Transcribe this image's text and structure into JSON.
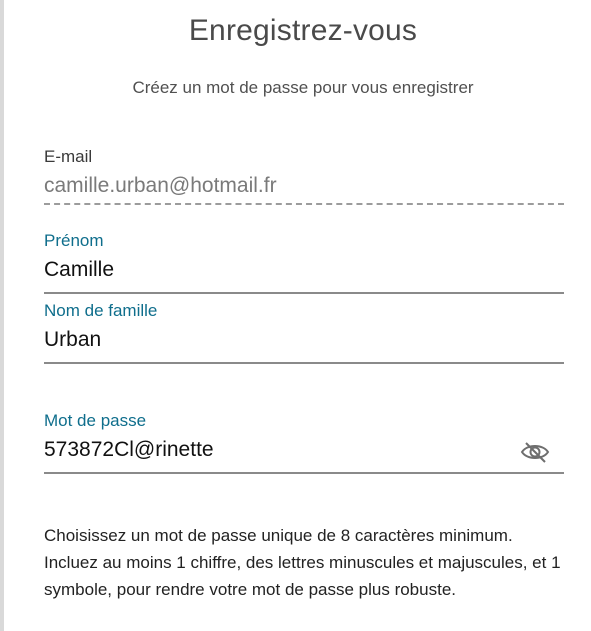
{
  "header": {
    "title": "Enregistrez-vous",
    "subtitle": "Créez un mot de passe pour vous enregistrer"
  },
  "form": {
    "email": {
      "label": "E-mail",
      "value": "camille.urban@hotmail.fr"
    },
    "first_name": {
      "label": "Prénom",
      "value": "Camille"
    },
    "last_name": {
      "label": "Nom de famille",
      "value": "Urban"
    },
    "password": {
      "label": "Mot de passe",
      "value": "573872Cl@rinette",
      "toggle_icon": "eye-slash-icon"
    }
  },
  "help": {
    "text": "Choisissez un mot de passe unique de 8 caractères minimum. Incluez au moins 1 chiffre, des lettres minuscules et majuscules, et 1 symbole, pour rendre votre mot de passe plus robuste."
  },
  "colors": {
    "label_accent": "#0f6e8c",
    "underline": "#8a8a8a"
  }
}
